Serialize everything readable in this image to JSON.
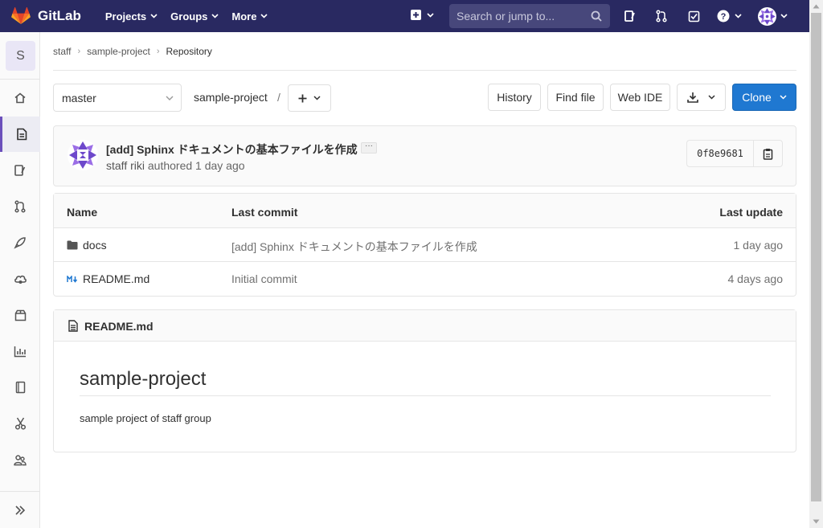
{
  "navbar": {
    "brand": "GitLab",
    "menu": [
      {
        "label": "Projects"
      },
      {
        "label": "Groups"
      },
      {
        "label": "More"
      }
    ],
    "search_placeholder": "Search or jump to..."
  },
  "sidebar": {
    "project_initial": "S",
    "items": [
      {
        "name": "project-overview",
        "icon": "home-icon"
      },
      {
        "name": "repository",
        "icon": "doc-icon",
        "active": true
      },
      {
        "name": "issues",
        "icon": "issues-icon"
      },
      {
        "name": "merge-requests",
        "icon": "merge-request-icon"
      },
      {
        "name": "ci-cd",
        "icon": "rocket-icon"
      },
      {
        "name": "operations",
        "icon": "cloud-icon"
      },
      {
        "name": "packages",
        "icon": "package-icon"
      },
      {
        "name": "analytics",
        "icon": "chart-icon"
      },
      {
        "name": "wiki",
        "icon": "book-icon"
      },
      {
        "name": "snippets",
        "icon": "scissors-icon"
      },
      {
        "name": "members",
        "icon": "users-icon"
      }
    ]
  },
  "breadcrumbs": {
    "group": "staff",
    "project": "sample-project",
    "current": "Repository"
  },
  "toolbar": {
    "branch": "master",
    "path": "sample-project",
    "path_separator": "/",
    "history": "History",
    "find_file": "Find file",
    "web_ide": "Web IDE",
    "clone": "Clone"
  },
  "last_commit": {
    "title": "[add] Sphinx ドキュメントの基本ファイルを作成",
    "ellipsis": "···",
    "author": "staff riki",
    "authored": "authored",
    "time": "1 day ago",
    "sha": "0f8e9681"
  },
  "file_table": {
    "headers": {
      "name": "Name",
      "last_commit": "Last commit",
      "last_update": "Last update"
    },
    "rows": [
      {
        "name": "docs",
        "type": "folder",
        "commit": "[add] Sphinx ドキュメントの基本ファイルを作成",
        "updated": "1 day ago"
      },
      {
        "name": "README.md",
        "type": "markdown",
        "commit": "Initial commit",
        "updated": "4 days ago"
      }
    ]
  },
  "readme": {
    "file": "README.md",
    "title": "sample-project",
    "body": "sample project of staff group"
  },
  "colors": {
    "navbar": "#292961",
    "accent": "#6b4fbb",
    "clone_button": "#1f78d1"
  }
}
